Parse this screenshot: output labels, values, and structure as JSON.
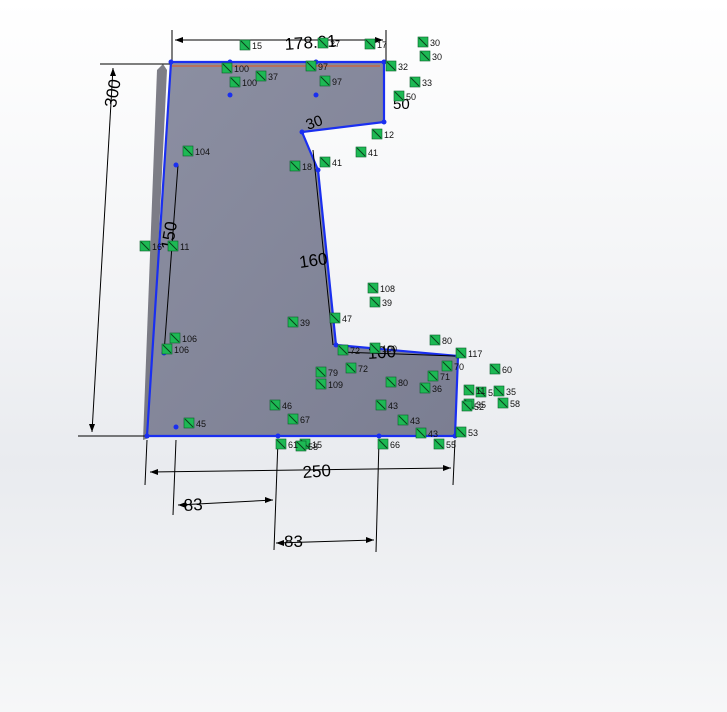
{
  "sketch": {
    "dimensions": {
      "top_width": "178.01",
      "left_height": "300",
      "bottom_width": "250",
      "bottom_left_offset": "83",
      "bottom_second_offset": "83",
      "slanted_edge": "160",
      "left_inner": "150",
      "notch": "100",
      "upper_right": "50",
      "radius": "30"
    },
    "relation_labels": [
      "15",
      "27",
      "17",
      "30",
      "30",
      "32",
      "33",
      "100",
      "97",
      "97",
      "37",
      "100",
      "50",
      "12",
      "104",
      "41",
      "41",
      "18",
      "11",
      "16",
      "108",
      "39",
      "106",
      "39",
      "106",
      "80",
      "72",
      "72",
      "100",
      "117",
      "79",
      "109",
      "80",
      "36",
      "52",
      "60",
      "35",
      "58",
      "35",
      "43",
      "43",
      "46",
      "45",
      "67",
      "43",
      "15",
      "58",
      "55",
      "53",
      "71",
      "70",
      "52",
      "11",
      "66",
      "47",
      "61"
    ],
    "colors": {
      "face": "#84879a",
      "edge": "#1a2ff0",
      "shadow": "#3a3a48",
      "dimension": "#000000",
      "relation_badge": "#1db954",
      "endpoint": "#1a2ff0",
      "inference": "#e2561a"
    }
  }
}
